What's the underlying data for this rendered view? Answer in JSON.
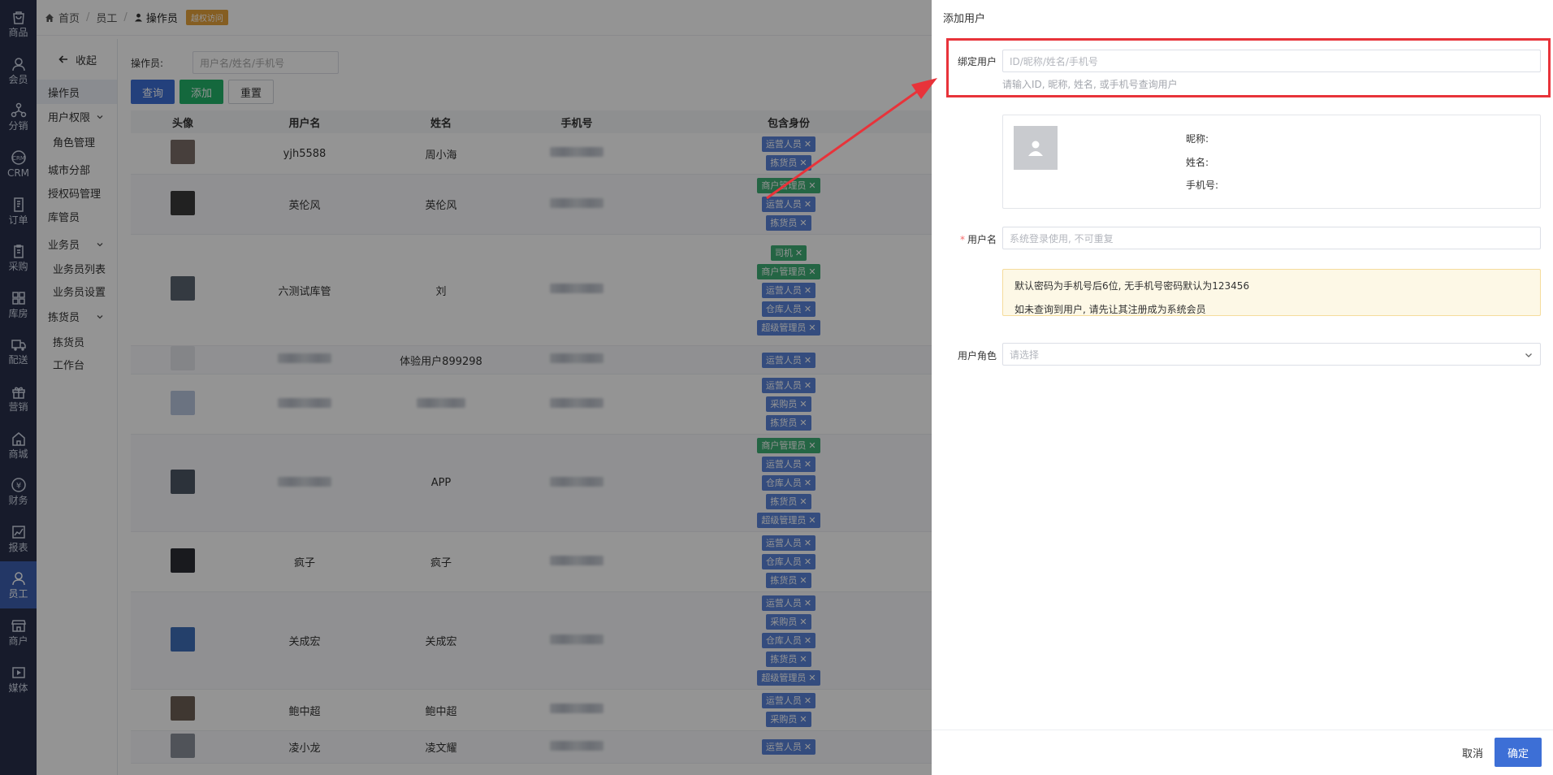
{
  "rail": [
    {
      "label": "商品",
      "icon": "bag-icon"
    },
    {
      "label": "会员",
      "icon": "user-icon"
    },
    {
      "label": "分销",
      "icon": "network-icon"
    },
    {
      "label": "CRM",
      "icon": "crm-icon"
    },
    {
      "label": "订单",
      "icon": "document-icon"
    },
    {
      "label": "采购",
      "icon": "clipboard-icon"
    },
    {
      "label": "库房",
      "icon": "grid-icon"
    },
    {
      "label": "配送",
      "icon": "truck-icon"
    },
    {
      "label": "营销",
      "icon": "gift-icon"
    },
    {
      "label": "商城",
      "icon": "home-icon"
    },
    {
      "label": "财务",
      "icon": "yen-icon"
    },
    {
      "label": "报表",
      "icon": "chart-icon"
    },
    {
      "label": "员工",
      "icon": "staff-icon",
      "active": true
    },
    {
      "label": "商户",
      "icon": "shop-icon"
    },
    {
      "label": "媒体",
      "icon": "play-icon"
    }
  ],
  "breadcrumb": {
    "home": "首页",
    "level2": "员工",
    "current": "操作员",
    "badge": "越权访问"
  },
  "subnav": {
    "collapse": "收起",
    "items": [
      {
        "label": "操作员",
        "active": true
      },
      {
        "label": "用户权限",
        "chevron": true
      },
      {
        "label": "角色管理",
        "sub": true
      },
      {
        "label": "城市分部"
      },
      {
        "label": "授权码管理"
      },
      {
        "label": "库管员"
      },
      {
        "label": "业务员",
        "chevron": true
      },
      {
        "label": "业务员列表",
        "sub": true
      },
      {
        "label": "业务员设置",
        "sub": true
      },
      {
        "label": "拣货员",
        "chevron": true
      },
      {
        "label": "拣货员",
        "sub": true
      },
      {
        "label": "工作台",
        "sub": true
      }
    ]
  },
  "filter": {
    "label": "操作员:",
    "placeholder": "用户名/姓名/手机号"
  },
  "buttons": {
    "query": "查询",
    "add": "添加",
    "reset": "重置"
  },
  "table": {
    "headers": [
      "头像",
      "用户名",
      "姓名",
      "手机号",
      "包含身份"
    ],
    "rows": [
      {
        "username": "yjh5588",
        "name": "周小海",
        "avatar": "#7a6d68",
        "tags": [
          {
            "t": "运营人员",
            "c": "blue"
          },
          {
            "t": "拣货员",
            "c": "blue"
          }
        ]
      },
      {
        "username": "英伦风",
        "name": "英伦风",
        "avatar": "#3a3a3a",
        "tags": [
          {
            "t": "商户管理员",
            "c": "green"
          },
          {
            "t": "运营人员",
            "c": "blue"
          },
          {
            "t": "拣货员",
            "c": "blue"
          }
        ]
      },
      {
        "username": "六测试库管",
        "name": "刘",
        "avatar": "#5b6470",
        "tags": [
          {
            "t": "司机",
            "c": "green"
          },
          {
            "t": "商户管理员",
            "c": "green"
          },
          {
            "t": "运营人员",
            "c": "blue"
          },
          {
            "t": "仓库人员",
            "c": "blue"
          },
          {
            "t": "超级管理员",
            "c": "blue"
          }
        ]
      },
      {
        "username": "",
        "name": "体验用户899298",
        "avatar": "#e4e6ea",
        "blur_user": true,
        "tags": [
          {
            "t": "运营人员",
            "c": "blue"
          }
        ]
      },
      {
        "username": "",
        "name": "",
        "avatar": "#b9c6de",
        "blur_user": true,
        "blur_name": true,
        "tags": [
          {
            "t": "运营人员",
            "c": "blue"
          },
          {
            "t": "采购员",
            "c": "blue"
          },
          {
            "t": "拣货员",
            "c": "blue"
          }
        ]
      },
      {
        "username": "",
        "name": "APP",
        "avatar": "#4d5664",
        "blur_user": true,
        "tags": [
          {
            "t": "商户管理员",
            "c": "green"
          },
          {
            "t": "运营人员",
            "c": "blue"
          },
          {
            "t": "仓库人员",
            "c": "blue"
          },
          {
            "t": "拣货员",
            "c": "blue"
          },
          {
            "t": "超级管理员",
            "c": "blue"
          }
        ]
      },
      {
        "username": "疯子",
        "name": "疯子",
        "avatar": "#2b2e35",
        "tags": [
          {
            "t": "运营人员",
            "c": "blue"
          },
          {
            "t": "仓库人员",
            "c": "blue"
          },
          {
            "t": "拣货员",
            "c": "blue"
          }
        ]
      },
      {
        "username": "关成宏",
        "name": "关成宏",
        "avatar": "#3e6fb8",
        "tags": [
          {
            "t": "运营人员",
            "c": "blue"
          },
          {
            "t": "采购员",
            "c": "blue"
          },
          {
            "t": "仓库人员",
            "c": "blue"
          },
          {
            "t": "拣货员",
            "c": "blue"
          },
          {
            "t": "超级管理员",
            "c": "blue"
          }
        ]
      },
      {
        "username": "鲍中超",
        "name": "鲍中超",
        "avatar": "#6d6055",
        "tags": [
          {
            "t": "运营人员",
            "c": "blue"
          },
          {
            "t": "采购员",
            "c": "blue"
          }
        ]
      },
      {
        "username": "凌小龙",
        "name": "凌文耀",
        "avatar": "#8a8f99",
        "tags": [
          {
            "t": "运营人员",
            "c": "blue"
          }
        ]
      }
    ]
  },
  "drawer": {
    "title": "添加用户",
    "bind_user": {
      "label": "绑定用户",
      "placeholder": "ID/昵称/姓名/手机号",
      "hint": "请输入ID, 昵称, 姓名, 或手机号查询用户"
    },
    "card": {
      "nickname": "昵称:",
      "name": "姓名:",
      "phone": "手机号:"
    },
    "username": {
      "label": "用户名",
      "placeholder": "系统登录使用, 不可重复"
    },
    "notice": {
      "line1": "默认密码为手机号后6位, 无手机号密码默认为123456",
      "line2": "如未查询到用户, 请先让其注册成为系统会员"
    },
    "role": {
      "label": "用户角色",
      "placeholder": "请选择"
    },
    "cancel": "取消",
    "confirm": "确定"
  },
  "colors": {
    "rail_bg": "#28304a",
    "rail_active": "#3d5fb0",
    "primary": "#3d6fd6",
    "success": "#23b36a",
    "danger": "#e8333a",
    "warning": "#e6a23c"
  }
}
